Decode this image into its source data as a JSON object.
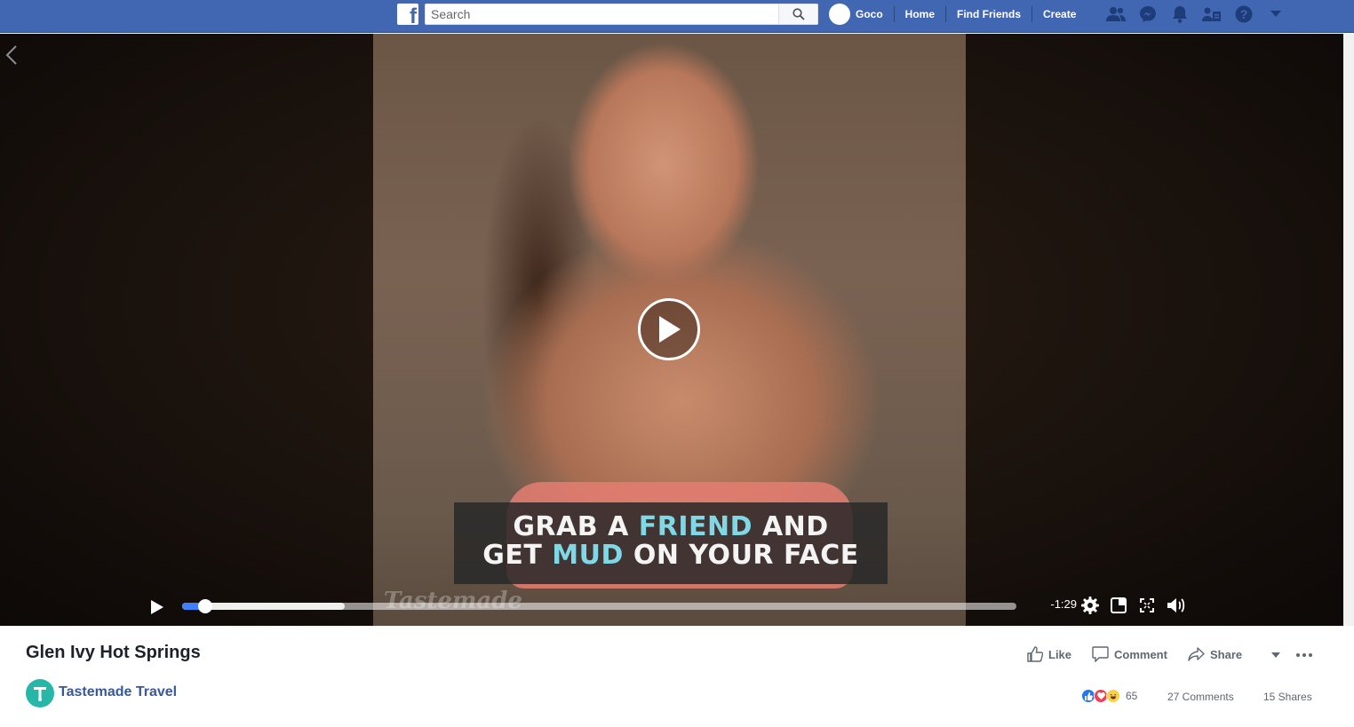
{
  "topbar": {
    "search_placeholder": "Search",
    "user_name": "Goco",
    "nav_home": "Home",
    "nav_find_friends": "Find Friends",
    "nav_create": "Create",
    "icons": [
      "friends-icon",
      "messenger-icon",
      "notifications-icon",
      "quick-help-icon",
      "help-icon",
      "dropdown-icon"
    ]
  },
  "video": {
    "caption_line1_a": "GRAB A ",
    "caption_line1_b": "FRIEND",
    "caption_line1_c": " AND",
    "caption_line2_a": "GET ",
    "caption_line2_b": "MUD",
    "caption_line2_c": " ON YOUR FACE",
    "watermark": "Tastemade",
    "time_remaining": "-1:29",
    "progress_fraction": 0.028,
    "buffered_fraction": 0.195
  },
  "post": {
    "title": "Glen Ivy Hot Springs",
    "page_name": "Tastemade Travel",
    "like_label": "Like",
    "comment_label": "Comment",
    "share_label": "Share",
    "reaction_count": "65",
    "comments_count": "27 Comments",
    "shares_count": "15 Shares"
  },
  "colors": {
    "facebook_blue": "#4267b2",
    "link_blue": "#385898",
    "progress_blue": "#4080ff",
    "caption_highlight": "#7fd8e6"
  }
}
